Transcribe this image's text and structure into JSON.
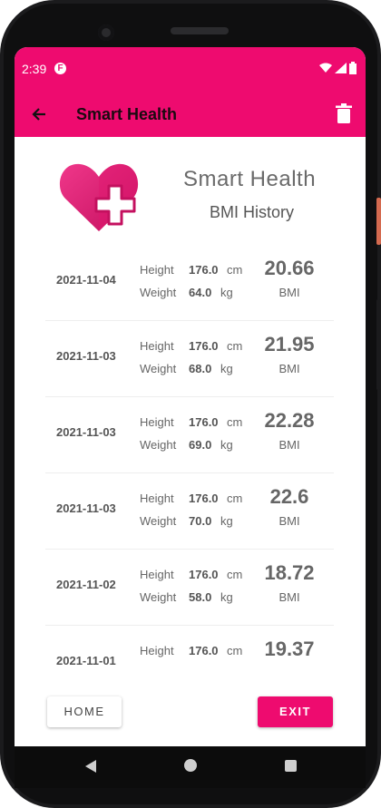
{
  "status": {
    "time": "2:39"
  },
  "appbar": {
    "title": "Smart Health"
  },
  "header": {
    "title": "Smart Health",
    "subtitle": "BMI History"
  },
  "labels": {
    "height": "Height",
    "weight": "Weight",
    "cm": "cm",
    "kg": "kg",
    "bmi": "BMI"
  },
  "records": [
    {
      "date": "2021-11-04",
      "height": "176.0",
      "weight": "64.0",
      "bmi": "20.66"
    },
    {
      "date": "2021-11-03",
      "height": "176.0",
      "weight": "68.0",
      "bmi": "21.95"
    },
    {
      "date": "2021-11-03",
      "height": "176.0",
      "weight": "69.0",
      "bmi": "22.28"
    },
    {
      "date": "2021-11-03",
      "height": "176.0",
      "weight": "70.0",
      "bmi": "22.6"
    },
    {
      "date": "2021-11-02",
      "height": "176.0",
      "weight": "58.0",
      "bmi": "18.72"
    },
    {
      "date": "2021-11-01",
      "height": "176.0",
      "weight": "",
      "bmi": "19.37"
    }
  ],
  "buttons": {
    "home": "HOME",
    "exit": "EXIT"
  },
  "colors": {
    "accent": "#ee0b6f"
  },
  "icons": [
    "back-arrow-icon",
    "trash-icon",
    "heart-plus-logo-icon",
    "wifi-icon",
    "signal-icon",
    "battery-icon"
  ]
}
